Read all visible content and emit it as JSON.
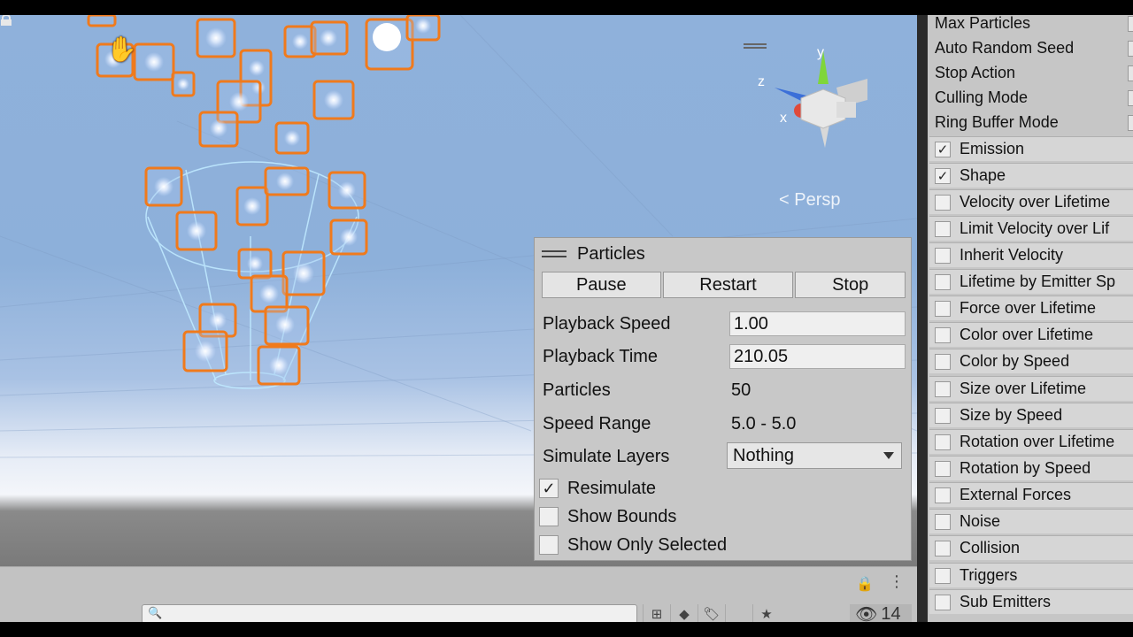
{
  "scene": {
    "view_label": "Persp",
    "gizmo_axes": {
      "y": "y",
      "z": "z",
      "x": "x"
    }
  },
  "particles_panel": {
    "title": "Particles",
    "buttons": {
      "pause": "Pause",
      "restart": "Restart",
      "stop": "Stop"
    },
    "playback_speed": {
      "label": "Playback Speed",
      "value": "1.00"
    },
    "playback_time": {
      "label": "Playback Time",
      "value": "210.05"
    },
    "particles": {
      "label": "Particles",
      "value": "50"
    },
    "speed_range": {
      "label": "Speed Range",
      "value": "5.0 - 5.0"
    },
    "simulate_layers": {
      "label": "Simulate Layers",
      "value": "Nothing"
    },
    "resimulate": {
      "label": "Resimulate",
      "checked": true
    },
    "show_bounds": {
      "label": "Show Bounds",
      "checked": false
    },
    "show_only_selected": {
      "label": "Show Only Selected",
      "checked": false
    }
  },
  "bottom_bar": {
    "hidden_count": "14"
  },
  "inspector": {
    "properties": [
      "Max Particles",
      "Auto Random Seed",
      "Stop Action",
      "Culling Mode",
      "Ring Buffer Mode"
    ],
    "modules": [
      {
        "label": "Emission",
        "checked": true
      },
      {
        "label": "Shape",
        "checked": true
      },
      {
        "label": "Velocity over Lifetime",
        "checked": false
      },
      {
        "label": "Limit Velocity over Lif",
        "checked": false
      },
      {
        "label": "Inherit Velocity",
        "checked": false
      },
      {
        "label": "Lifetime by Emitter Sp",
        "checked": false
      },
      {
        "label": "Force over Lifetime",
        "checked": false
      },
      {
        "label": "Color over Lifetime",
        "checked": false
      },
      {
        "label": "Color by Speed",
        "checked": false
      },
      {
        "label": "Size over Lifetime",
        "checked": false
      },
      {
        "label": "Size by Speed",
        "checked": false
      },
      {
        "label": "Rotation over Lifetime",
        "checked": false
      },
      {
        "label": "Rotation by Speed",
        "checked": false
      },
      {
        "label": "External Forces",
        "checked": false
      },
      {
        "label": "Noise",
        "checked": false
      },
      {
        "label": "Collision",
        "checked": false
      },
      {
        "label": "Triggers",
        "checked": false
      },
      {
        "label": "Sub Emitters",
        "checked": false
      }
    ]
  }
}
